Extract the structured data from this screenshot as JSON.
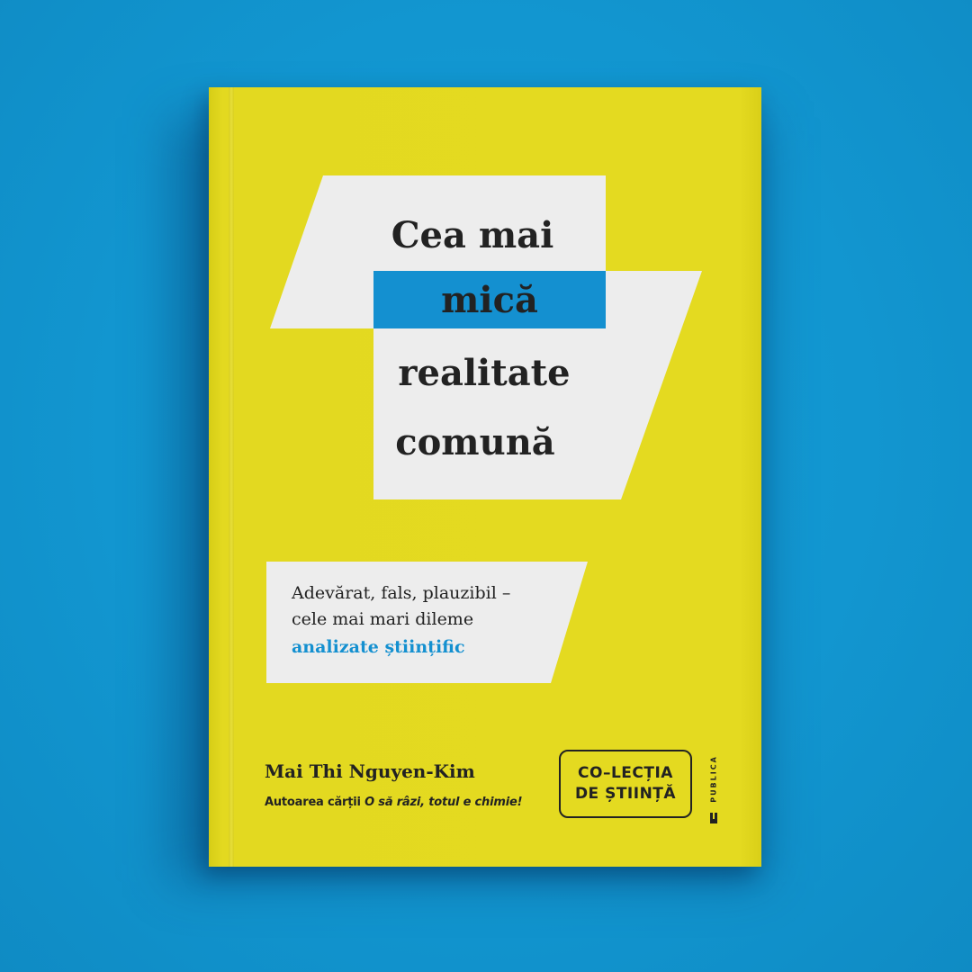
{
  "background_color": "#1296d0",
  "book": {
    "cover_color": "#e4da20",
    "accent_color": "#1490d0",
    "title_lines": [
      "Cea mai",
      "mică",
      "realitate",
      "comună"
    ],
    "subtitle_lines": [
      "Adevărat, fals, plauzibil –",
      "cele mai mari dileme",
      "analizate științific"
    ],
    "author": "Mai Thi Nguyen-Kim",
    "author_note_prefix": "Autoarea cărții ",
    "author_note_book": "O să râzi, totul e chimie!",
    "collection_lines": [
      "CO–LECȚIA",
      "DE ȘTIINȚĂ"
    ],
    "publisher": "PUBLICA"
  }
}
